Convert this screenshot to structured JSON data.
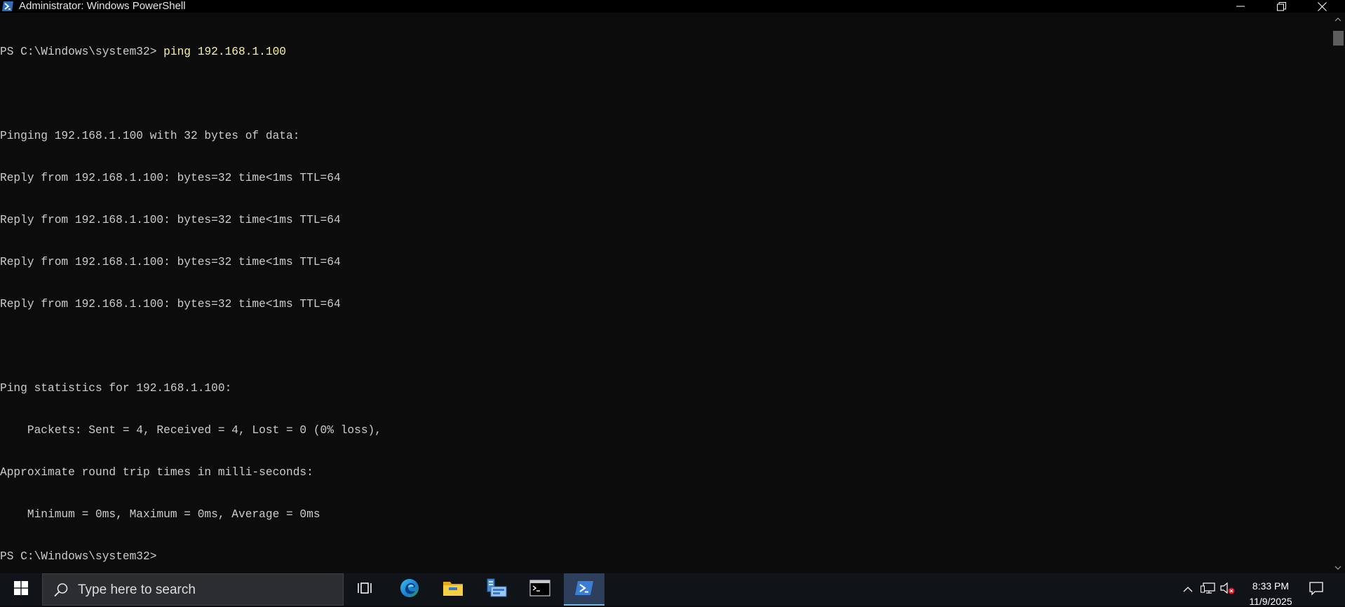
{
  "window": {
    "title": "Administrator: Windows PowerShell",
    "icons": {
      "app": "powershell-icon",
      "minimize": "minimize-icon",
      "restore": "restore-icon",
      "close": "close-icon"
    }
  },
  "console": {
    "prompt": "PS C:\\Windows\\system32>",
    "command": "ping 192.168.1.100",
    "output": [
      "",
      "Pinging 192.168.1.100 with 32 bytes of data:",
      "Reply from 192.168.1.100: bytes=32 time<1ms TTL=64",
      "Reply from 192.168.1.100: bytes=32 time<1ms TTL=64",
      "Reply from 192.168.1.100: bytes=32 time<1ms TTL=64",
      "Reply from 192.168.1.100: bytes=32 time<1ms TTL=64",
      "",
      "Ping statistics for 192.168.1.100:",
      "    Packets: Sent = 4, Received = 4, Lost = 0 (0% loss),",
      "Approximate round trip times in milli-seconds:",
      "    Minimum = 0ms, Maximum = 0ms, Average = 0ms"
    ],
    "final_prompt": "PS C:\\Windows\\system32>",
    "colors": {
      "background": "#0c0c0c",
      "text": "#cccccc",
      "command": "#f9f1a5"
    }
  },
  "taskbar": {
    "search_placeholder": "Type here to search",
    "icons": {
      "start": "windows-start-icon",
      "search": "search-icon",
      "task_view": "task-view-icon",
      "edge": "edge-icon",
      "file_explorer": "file-explorer-icon",
      "server_manager": "server-manager-icon",
      "cmd": "command-prompt-icon",
      "powershell": "powershell-icon"
    },
    "tray": {
      "chevron": "chevron-up-icon",
      "network": "network-icon",
      "volume": "volume-muted-icon",
      "notifications": "notification-icon"
    },
    "clock": {
      "time": "8:33 PM",
      "date": "11/9/2025"
    },
    "accent_color": "#76b9ed"
  }
}
